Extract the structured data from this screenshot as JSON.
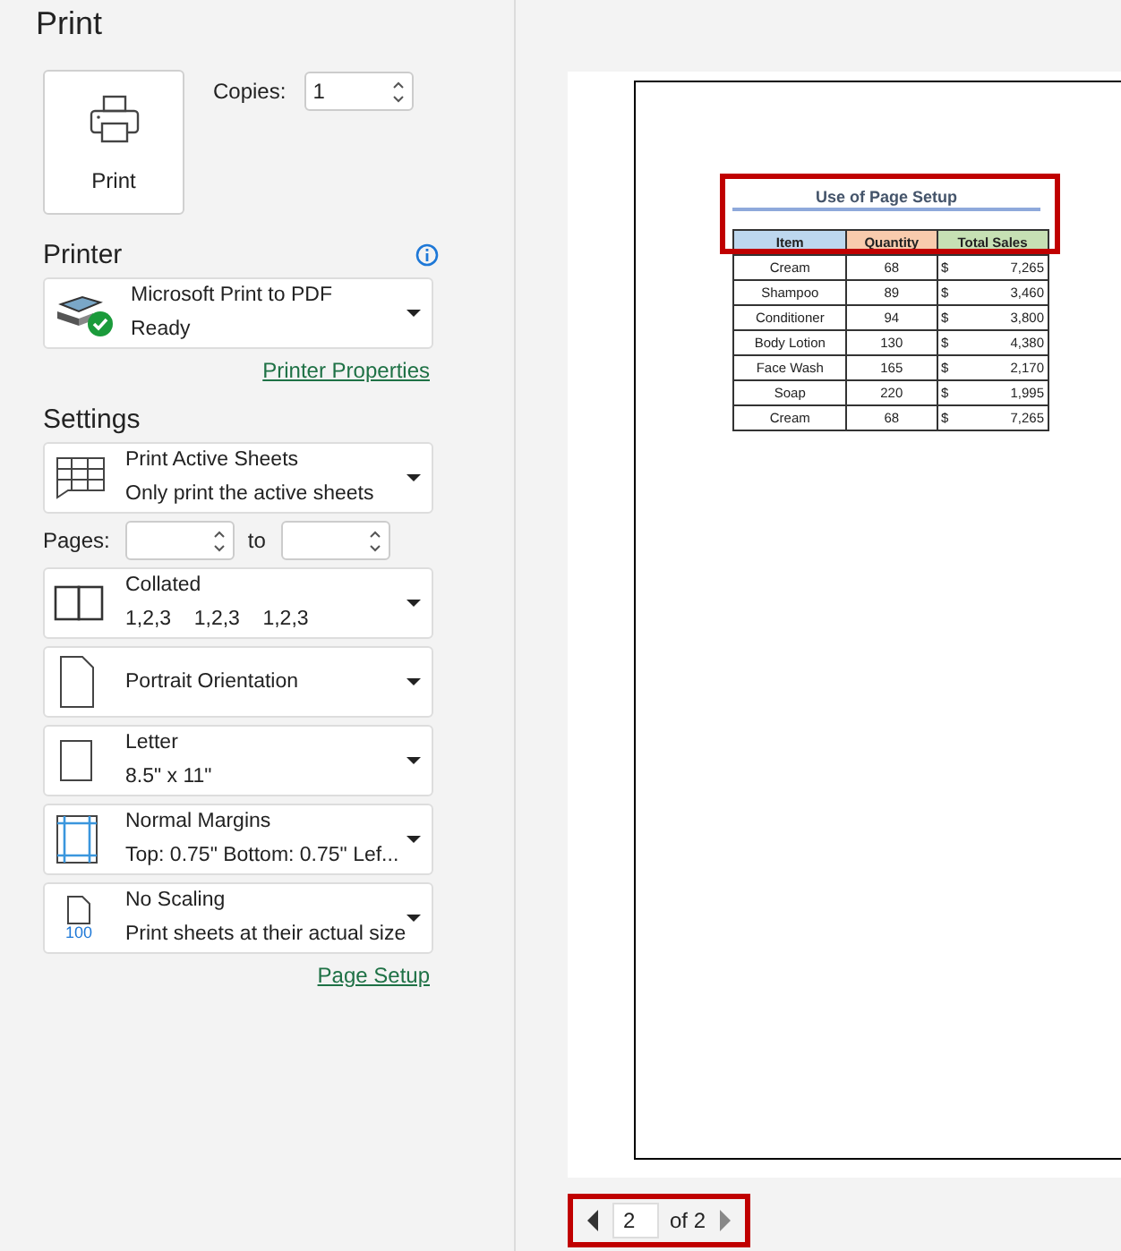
{
  "title": "Print",
  "print_button": {
    "label": "Print"
  },
  "copies": {
    "label": "Copies:",
    "value": "1"
  },
  "printer": {
    "heading": "Printer",
    "name": "Microsoft Print to PDF",
    "status": "Ready",
    "properties_link": "Printer Properties"
  },
  "settings": {
    "heading": "Settings",
    "items": [
      {
        "kind": "sheets",
        "title": "Print Active Sheets",
        "subtitle": "Only print the active sheets"
      },
      {
        "kind": "pages",
        "label": "Pages:",
        "to": "to"
      },
      {
        "kind": "collated",
        "title": "Collated",
        "subtitle": "1,2,3    1,2,3    1,2,3"
      },
      {
        "kind": "orientation",
        "title": "Portrait Orientation"
      },
      {
        "kind": "paper",
        "title": "Letter",
        "subtitle": "8.5\" x 11\""
      },
      {
        "kind": "margins",
        "title": "Normal Margins",
        "subtitle": "Top: 0.75\" Bottom: 0.75\" Lef..."
      },
      {
        "kind": "scaling",
        "title": "No Scaling",
        "subtitle": "Print sheets at their actual size",
        "icon_text": "100"
      }
    ],
    "page_setup_link": "Page Setup"
  },
  "preview": {
    "title": "Use of Page Setup",
    "columns": [
      {
        "label": "Item",
        "color": "#bdd7ee"
      },
      {
        "label": "Quantity",
        "color": "#f8cbad"
      },
      {
        "label": "Total Sales",
        "color": "#c6e0b4"
      }
    ],
    "rows": [
      {
        "item": "Cream",
        "quantity": "68",
        "currency": "$",
        "amount": "7,265"
      },
      {
        "item": "Shampoo",
        "quantity": "89",
        "currency": "$",
        "amount": "3,460"
      },
      {
        "item": "Conditioner",
        "quantity": "94",
        "currency": "$",
        "amount": "3,800"
      },
      {
        "item": "Body Lotion",
        "quantity": "130",
        "currency": "$",
        "amount": "4,380"
      },
      {
        "item": "Face Wash",
        "quantity": "165",
        "currency": "$",
        "amount": "2,170"
      },
      {
        "item": "Soap",
        "quantity": "220",
        "currency": "$",
        "amount": "1,995"
      },
      {
        "item": "Cream",
        "quantity": "68",
        "currency": "$",
        "amount": "7,265"
      }
    ]
  },
  "navigation": {
    "page": "2",
    "of": "of 2"
  }
}
